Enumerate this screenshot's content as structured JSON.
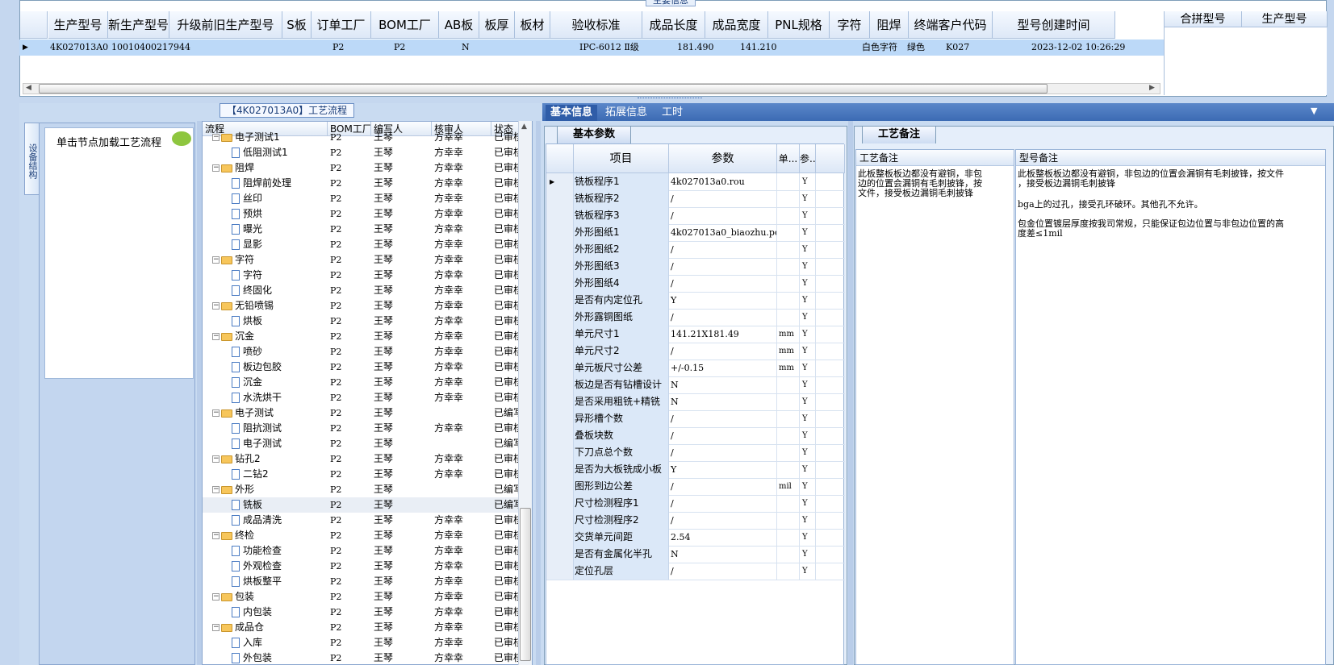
{
  "top": {
    "caption": "主要信息",
    "columns": [
      "生产型号",
      "新生产型号",
      "升级前旧生产型号",
      "S板",
      "订单工厂",
      "BOM工厂",
      "AB板",
      "板厚",
      "板材",
      "验收标准",
      "成品长度",
      "成品宽度",
      "PNL规格",
      "字符",
      "阻焊",
      "终端客户代码",
      "型号创建时间"
    ],
    "row": {
      "prod_no": "4K027013A0",
      "new_prod_no": "10010400217944",
      "order_factory": "P2",
      "bom_factory": "P2",
      "ab": "N",
      "standard": "IPC-6012 Ⅱ级",
      "length": "181.490",
      "width": "141.210",
      "char": "白色字符",
      "mask": "绿色",
      "customer": "K027",
      "created": "2023-12-02 10:26:29"
    },
    "merge_columns": [
      "合拼型号",
      "生产型号"
    ]
  },
  "side": {
    "tab": "设备结构",
    "hint": "单击节点加载工艺流程"
  },
  "process": {
    "caption": "【4K027013A0】工艺流程",
    "columns": [
      "流程",
      "BOM工厂",
      "编写人",
      "核审人",
      "状态"
    ],
    "rows": [
      {
        "name": "电子测试1",
        "level": 1,
        "bom": "P2",
        "author": "王琴",
        "reviewer": "方幸幸",
        "status": "已审核"
      },
      {
        "name": "低阻测试1",
        "level": 2,
        "bom": "P2",
        "author": "王琴",
        "reviewer": "方幸幸",
        "status": "已审核"
      },
      {
        "name": "阻焊",
        "level": 1,
        "bom": "P2",
        "author": "王琴",
        "reviewer": "方幸幸",
        "status": "已审核"
      },
      {
        "name": "阻焊前处理",
        "level": 2,
        "bom": "P2",
        "author": "王琴",
        "reviewer": "方幸幸",
        "status": "已审核"
      },
      {
        "name": "丝印",
        "level": 2,
        "bom": "P2",
        "author": "王琴",
        "reviewer": "方幸幸",
        "status": "已审核"
      },
      {
        "name": "预烘",
        "level": 2,
        "bom": "P2",
        "author": "王琴",
        "reviewer": "方幸幸",
        "status": "已审核"
      },
      {
        "name": "曝光",
        "level": 2,
        "bom": "P2",
        "author": "王琴",
        "reviewer": "方幸幸",
        "status": "已审核"
      },
      {
        "name": "显影",
        "level": 2,
        "bom": "P2",
        "author": "王琴",
        "reviewer": "方幸幸",
        "status": "已审核"
      },
      {
        "name": "字符",
        "level": 1,
        "bom": "P2",
        "author": "王琴",
        "reviewer": "方幸幸",
        "status": "已审核"
      },
      {
        "name": "字符",
        "level": 2,
        "bom": "P2",
        "author": "王琴",
        "reviewer": "方幸幸",
        "status": "已审核"
      },
      {
        "name": "终固化",
        "level": 2,
        "bom": "P2",
        "author": "王琴",
        "reviewer": "方幸幸",
        "status": "已审核"
      },
      {
        "name": "无铅喷锡",
        "level": 1,
        "bom": "P2",
        "author": "王琴",
        "reviewer": "方幸幸",
        "status": "已审核"
      },
      {
        "name": "烘板",
        "level": 2,
        "bom": "P2",
        "author": "王琴",
        "reviewer": "方幸幸",
        "status": "已审核"
      },
      {
        "name": "沉金",
        "level": 1,
        "bom": "P2",
        "author": "王琴",
        "reviewer": "方幸幸",
        "status": "已审核"
      },
      {
        "name": "喷砂",
        "level": 2,
        "bom": "P2",
        "author": "王琴",
        "reviewer": "方幸幸",
        "status": "已审核"
      },
      {
        "name": "板边包胶",
        "level": 2,
        "bom": "P2",
        "author": "王琴",
        "reviewer": "方幸幸",
        "status": "已审核"
      },
      {
        "name": "沉金",
        "level": 2,
        "bom": "P2",
        "author": "王琴",
        "reviewer": "方幸幸",
        "status": "已审核"
      },
      {
        "name": "水洗烘干",
        "level": 2,
        "bom": "P2",
        "author": "王琴",
        "reviewer": "方幸幸",
        "status": "已审核"
      },
      {
        "name": "电子测试",
        "level": 1,
        "bom": "P2",
        "author": "王琴",
        "reviewer": "",
        "status": "已编写"
      },
      {
        "name": "阻抗测试",
        "level": 2,
        "bom": "P2",
        "author": "王琴",
        "reviewer": "方幸幸",
        "status": "已审核"
      },
      {
        "name": "电子测试",
        "level": 2,
        "bom": "P2",
        "author": "王琴",
        "reviewer": "",
        "status": "已编写"
      },
      {
        "name": "钻孔2",
        "level": 1,
        "bom": "P2",
        "author": "王琴",
        "reviewer": "方幸幸",
        "status": "已审核"
      },
      {
        "name": "二钻2",
        "level": 2,
        "bom": "P2",
        "author": "王琴",
        "reviewer": "方幸幸",
        "status": "已审核"
      },
      {
        "name": "外形",
        "level": 1,
        "bom": "P2",
        "author": "王琴",
        "reviewer": "",
        "status": "已编写"
      },
      {
        "name": "铣板",
        "level": 2,
        "bom": "P2",
        "author": "王琴",
        "reviewer": "",
        "status": "已编写"
      },
      {
        "name": "成品清洗",
        "level": 2,
        "bom": "P2",
        "author": "王琴",
        "reviewer": "方幸幸",
        "status": "已审核"
      },
      {
        "name": "终检",
        "level": 1,
        "bom": "P2",
        "author": "王琴",
        "reviewer": "方幸幸",
        "status": "已审核"
      },
      {
        "name": "功能检查",
        "level": 2,
        "bom": "P2",
        "author": "王琴",
        "reviewer": "方幸幸",
        "status": "已审核"
      },
      {
        "name": "外观检查",
        "level": 2,
        "bom": "P2",
        "author": "王琴",
        "reviewer": "方幸幸",
        "status": "已审核"
      },
      {
        "name": "烘板整平",
        "level": 2,
        "bom": "P2",
        "author": "王琴",
        "reviewer": "方幸幸",
        "status": "已审核"
      },
      {
        "name": "包装",
        "level": 1,
        "bom": "P2",
        "author": "王琴",
        "reviewer": "方幸幸",
        "status": "已审核"
      },
      {
        "name": "内包装",
        "level": 2,
        "bom": "P2",
        "author": "王琴",
        "reviewer": "方幸幸",
        "status": "已审核"
      },
      {
        "name": "成品仓",
        "level": 1,
        "bom": "P2",
        "author": "王琴",
        "reviewer": "方幸幸",
        "status": "已审核"
      },
      {
        "name": "入库",
        "level": 2,
        "bom": "P2",
        "author": "王琴",
        "reviewer": "方幸幸",
        "status": "已审核"
      },
      {
        "name": "外包装",
        "level": 2,
        "bom": "P2",
        "author": "王琴",
        "reviewer": "方幸幸",
        "status": "已审核"
      }
    ]
  },
  "tabs": [
    "基本信息",
    "拓展信息",
    "工时"
  ],
  "basic": {
    "title": "基本参数",
    "columns": [
      "项目",
      "参数",
      "单...",
      "参..."
    ],
    "rows": [
      {
        "name": "铣板程序1",
        "value": "4k027013a0.rou",
        "unit": "",
        "flag": "Y"
      },
      {
        "name": "铣板程序2",
        "value": "/",
        "unit": "",
        "flag": "Y"
      },
      {
        "name": "铣板程序3",
        "value": "/",
        "unit": "",
        "flag": "Y"
      },
      {
        "name": "外形图纸1",
        "value": "4k027013a0_biaozhu.pdf",
        "unit": "",
        "flag": "Y"
      },
      {
        "name": "外形图纸2",
        "value": "/",
        "unit": "",
        "flag": "Y"
      },
      {
        "name": "外形图纸3",
        "value": "/",
        "unit": "",
        "flag": "Y"
      },
      {
        "name": "外形图纸4",
        "value": "/",
        "unit": "",
        "flag": "Y"
      },
      {
        "name": "是否有内定位孔",
        "value": "Y",
        "unit": "",
        "flag": "Y"
      },
      {
        "name": "外形露铜图纸",
        "value": "/",
        "unit": "",
        "flag": "Y"
      },
      {
        "name": "单元尺寸1",
        "value": "141.21X181.49",
        "unit": "mm",
        "flag": "Y"
      },
      {
        "name": "单元尺寸2",
        "value": "/",
        "unit": "mm",
        "flag": "Y"
      },
      {
        "name": "单元板尺寸公差",
        "value": "+/-0.15",
        "unit": "mm",
        "flag": "Y"
      },
      {
        "name": "板边是否有钻槽设计",
        "value": "N",
        "unit": "",
        "flag": "Y"
      },
      {
        "name": "是否采用粗铣+精铣",
        "value": "N",
        "unit": "",
        "flag": "Y"
      },
      {
        "name": "异形槽个数",
        "value": "/",
        "unit": "",
        "flag": "Y"
      },
      {
        "name": "叠板块数",
        "value": "/",
        "unit": "",
        "flag": "Y"
      },
      {
        "name": "下刀点总个数",
        "value": "/",
        "unit": "",
        "flag": "Y"
      },
      {
        "name": "是否为大板铣成小板",
        "value": "Y",
        "unit": "",
        "flag": "Y"
      },
      {
        "name": "图形到边公差",
        "value": "/",
        "unit": "mil",
        "flag": "Y"
      },
      {
        "name": "尺寸检测程序1",
        "value": "/",
        "unit": "",
        "flag": "Y"
      },
      {
        "name": "尺寸检测程序2",
        "value": "/",
        "unit": "",
        "flag": "Y"
      },
      {
        "name": "交货单元间距",
        "value": "2.54",
        "unit": "",
        "flag": "Y"
      },
      {
        "name": "是否有金属化半孔",
        "value": "N",
        "unit": "",
        "flag": "Y"
      },
      {
        "name": "定位孔层",
        "value": "/",
        "unit": "",
        "flag": "Y"
      }
    ]
  },
  "remark": {
    "title": "工艺备注",
    "col1_header": "工艺备注",
    "col1_text": "此板整板板边都没有避铜，非包\n边的位置会漏铜有毛刺披锋，按\n文件，接受板边漏铜毛刺披锋",
    "col2_header": "型号备注",
    "col2_line1": "此板整板板边都没有避铜，非包边的位置会漏铜有毛刺披锋，按文件\n，接受板边漏铜毛刺披锋",
    "col2_line2": "bga上的过孔，接受孔环破环。其他孔不允许。",
    "col2_line3": "包金位置镀层厚度按我司常规，只能保证包边位置与非包边位置的高\n度差≤1mil"
  }
}
